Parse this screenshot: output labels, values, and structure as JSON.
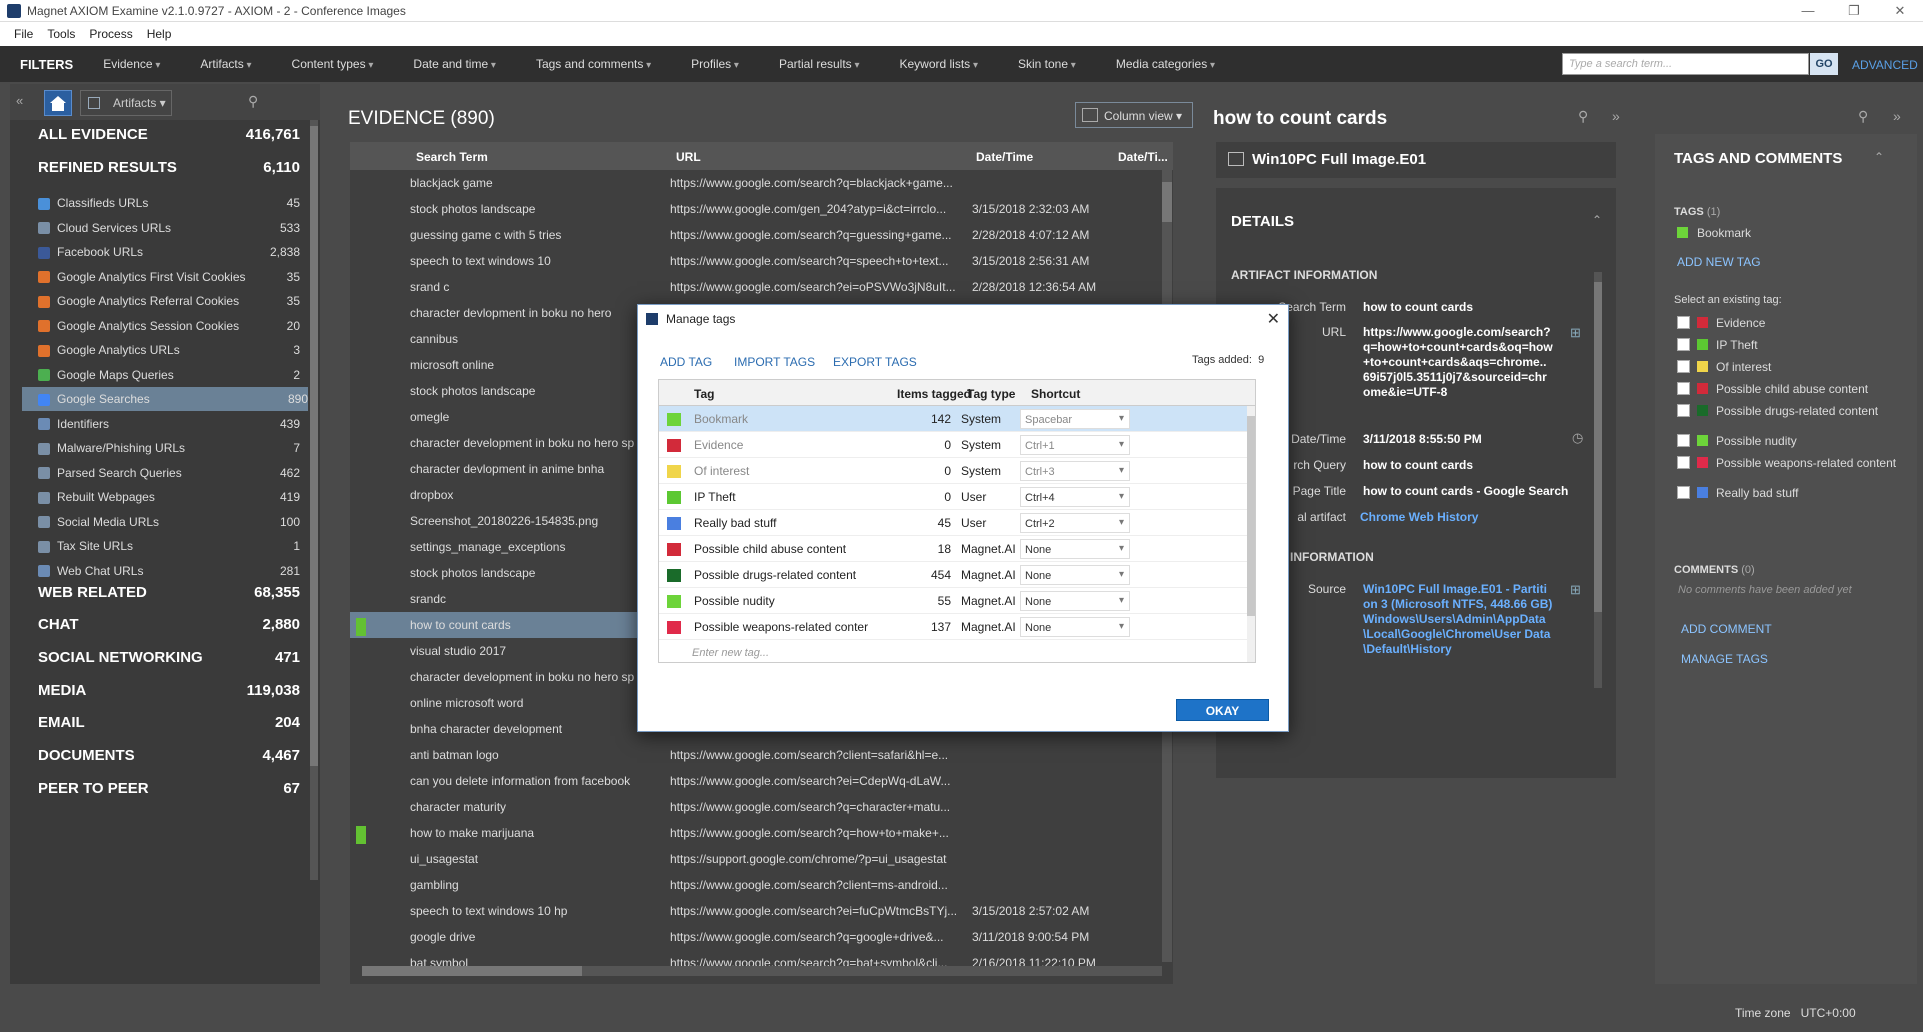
{
  "window": {
    "title": "Magnet AXIOM Examine v2.1.0.9727 - AXIOM - 2 - Conference Images"
  },
  "menu": [
    "File",
    "Tools",
    "Process",
    "Help"
  ],
  "filters": {
    "label": "FILTERS",
    "items": [
      "Evidence",
      "Artifacts",
      "Content types",
      "Date and time",
      "Tags and comments",
      "Profiles",
      "Partial results",
      "Keyword lists",
      "Skin tone",
      "Media categories"
    ],
    "search_placeholder": "Type a search term...",
    "go": "GO",
    "advanced": "ADVANCED"
  },
  "left": {
    "artifacts_btn": "Artifacts",
    "all_evidence": {
      "label": "ALL EVIDENCE",
      "count": "416,761"
    },
    "refined": {
      "label": "REFINED RESULTS",
      "count": "6,110"
    },
    "items": [
      {
        "label": "Classifieds URLs",
        "count": "45",
        "color": "#4a90d9"
      },
      {
        "label": "Cloud Services URLs",
        "count": "533",
        "color": "#7a8fa6"
      },
      {
        "label": "Facebook URLs",
        "count": "2,838",
        "color": "#3b5998"
      },
      {
        "label": "Google Analytics First Visit Cookies",
        "count": "35",
        "color": "#e0712c"
      },
      {
        "label": "Google Analytics Referral Cookies",
        "count": "35",
        "color": "#e0712c"
      },
      {
        "label": "Google Analytics Session Cookies",
        "count": "20",
        "color": "#e0712c"
      },
      {
        "label": "Google Analytics URLs",
        "count": "3",
        "color": "#e0712c"
      },
      {
        "label": "Google Maps Queries",
        "count": "2",
        "color": "#4caf50"
      },
      {
        "label": "Google Searches",
        "count": "890",
        "color": "#4285f4"
      },
      {
        "label": "Identifiers",
        "count": "439",
        "color": "#6b8bb5"
      },
      {
        "label": "Malware/Phishing URLs",
        "count": "7",
        "color": "#7a8fa6"
      },
      {
        "label": "Parsed Search Queries",
        "count": "462",
        "color": "#7a8fa6"
      },
      {
        "label": "Rebuilt Webpages",
        "count": "419",
        "color": "#7a8fa6"
      },
      {
        "label": "Social Media URLs",
        "count": "100",
        "color": "#7a8fa6"
      },
      {
        "label": "Tax Site URLs",
        "count": "1",
        "color": "#7a8fa6"
      },
      {
        "label": "Web Chat URLs",
        "count": "281",
        "color": "#6b8bb5"
      }
    ],
    "sections": [
      {
        "label": "WEB RELATED",
        "count": "68,355"
      },
      {
        "label": "CHAT",
        "count": "2,880"
      },
      {
        "label": "SOCIAL NETWORKING",
        "count": "471"
      },
      {
        "label": "MEDIA",
        "count": "119,038"
      },
      {
        "label": "EMAIL",
        "count": "204"
      },
      {
        "label": "DOCUMENTS",
        "count": "4,467"
      },
      {
        "label": "PEER TO PEER",
        "count": "67"
      }
    ]
  },
  "evidence": {
    "title": "EVIDENCE (890)",
    "column_view": "Column view",
    "columns": [
      "Search Term",
      "URL",
      "Date/Time",
      "Date/Ti..."
    ],
    "rows": [
      {
        "term": "blackjack game",
        "url": "https://www.google.com/search?q=blackjack+game...",
        "date": ""
      },
      {
        "term": "stock photos landscape",
        "url": "https://www.google.com/gen_204?atyp=i&ct=irrclo...",
        "date": "3/15/2018 2:32:03 AM"
      },
      {
        "term": "guessing game c   with 5 tries",
        "url": "https://www.google.com/search?q=guessing+game...",
        "date": "2/28/2018 4:07:12 AM"
      },
      {
        "term": "speech to text windows 10",
        "url": "https://www.google.com/search?q=speech+to+text...",
        "date": "3/15/2018 2:56:31 AM"
      },
      {
        "term": "srand c",
        "url": "https://www.google.com/search?ei=oPSVWo3jN8uIt...",
        "date": "2/28/2018 12:36:54 AM"
      },
      {
        "term": "character devlopment in boku no hero",
        "url": "",
        "date": ""
      },
      {
        "term": "cannibus",
        "url": "",
        "date": ""
      },
      {
        "term": "microsoft online",
        "url": "",
        "date": ""
      },
      {
        "term": "stock photos landscape",
        "url": "",
        "date": ""
      },
      {
        "term": "omegle",
        "url": "",
        "date": ""
      },
      {
        "term": "character development in boku no hero sp",
        "url": "",
        "date": ""
      },
      {
        "term": "character devlopment in anime bnha",
        "url": "",
        "date": ""
      },
      {
        "term": "dropbox",
        "url": "",
        "date": ""
      },
      {
        "term": "Screenshot_20180226-154835.png",
        "url": "",
        "date": ""
      },
      {
        "term": "settings_manage_exceptions",
        "url": "",
        "date": ""
      },
      {
        "term": "stock photos landscape",
        "url": "",
        "date": ""
      },
      {
        "term": "srandc",
        "url": "",
        "date": ""
      },
      {
        "term": "how to count cards",
        "url": "",
        "date": ""
      },
      {
        "term": "visual studio 2017",
        "url": "",
        "date": ""
      },
      {
        "term": "character development in boku no hero sp",
        "url": "",
        "date": ""
      },
      {
        "term": "online microsoft word",
        "url": "",
        "date": ""
      },
      {
        "term": "bnha character development",
        "url": "",
        "date": ""
      },
      {
        "term": "anti batman logo",
        "url": "https://www.google.com/search?client=safari&hl=e...",
        "date": ""
      },
      {
        "term": "can you delete information from facebook",
        "url": "https://www.google.com/search?ei=CdepWq-dLaW...",
        "date": ""
      },
      {
        "term": "character maturity",
        "url": "https://www.google.com/search?q=character+matu...",
        "date": ""
      },
      {
        "term": "how to make marijuana",
        "url": "https://www.google.com/search?q=how+to+make+...",
        "date": ""
      },
      {
        "term": "ui_usagestat",
        "url": "https://support.google.com/chrome/?p=ui_usagestat",
        "date": ""
      },
      {
        "term": "gambling",
        "url": "https://www.google.com/search?client=ms-android...",
        "date": ""
      },
      {
        "term": "speech to text windows 10 hp",
        "url": "https://www.google.com/search?ei=fuCpWtmcBsTYj...",
        "date": "3/15/2018 2:57:02 AM"
      },
      {
        "term": "google drive",
        "url": "https://www.google.com/search?q=google+drive&...",
        "date": "3/11/2018 9:00:54 PM"
      },
      {
        "term": "bat symbol",
        "url": "https://www.google.com/search?q=bat+symbol&cli...",
        "date": "2/16/2018 11:22:10 PM"
      }
    ]
  },
  "details": {
    "heading": "how to count cards",
    "source_image": "Win10PC Full Image.E01",
    "section": "DETAILS",
    "artifact_info": "ARTIFACT INFORMATION",
    "search_term_label": "Search Term",
    "search_term": "how to count cards",
    "url_label": "URL",
    "url": "https://www.google.com/search?q=how+to+count+cards&oq=how+to+count+cards&aqs=chrome..69i57j0l5.3511j0j7&sourceid=chrome&ie=UTF-8",
    "datetime_label": "Date/Time",
    "datetime": "3/11/2018 8:55:50 PM",
    "query_label": "rch Query",
    "query": "how to count cards",
    "pagetitle_label": "Page Title",
    "pagetitle": "how to count cards - Google Search",
    "artifact_label": "al artifact",
    "artifact": "Chrome Web History",
    "info2": "INFORMATION",
    "source_label": "Source",
    "source": "Win10PC Full Image.E01 - Partition 3 (Microsoft NTFS, 448.66 GB) Windows\\Users\\Admin\\AppData\\Local\\Google\\Chrome\\User Data\\Default\\History"
  },
  "tags_panel": {
    "title": "TAGS AND COMMENTS",
    "tags_label": "TAGS",
    "tags_count": "(1)",
    "bookmark": "Bookmark",
    "add_new_tag": "ADD NEW TAG",
    "select_existing": "Select an existing tag:",
    "existing": [
      {
        "label": "Evidence",
        "color": "#d22a3a"
      },
      {
        "label": "IP Theft",
        "color": "#5cc832"
      },
      {
        "label": "Of interest",
        "color": "#f0d54a"
      },
      {
        "label": "Possible child abuse content",
        "color": "#d22a3a"
      },
      {
        "label": "Possible drugs-related content",
        "color": "#1a6b2a"
      },
      {
        "label": "Possible nudity",
        "color": "#6dd43a"
      },
      {
        "label": "Possible weapons-related content",
        "color": "#e02a4a"
      },
      {
        "label": "Really bad stuff",
        "color": "#4a7fe0"
      }
    ],
    "comments_label": "COMMENTS",
    "comments_count": "(0)",
    "no_comments": "No comments have been added yet",
    "add_comment": "ADD COMMENT",
    "manage_tags": "MANAGE TAGS"
  },
  "status": {
    "timezone_label": "Time zone",
    "timezone": "UTC+0:00"
  },
  "dialog": {
    "title": "Manage tags",
    "add_tag": "ADD TAG",
    "import_tags": "IMPORT TAGS",
    "export_tags": "EXPORT TAGS",
    "tags_added_label": "Tags added:",
    "tags_added": "9",
    "columns": [
      "Tag",
      "Items tagged",
      "Tag type",
      "Shortcut"
    ],
    "rows": [
      {
        "tag": "Bookmark",
        "count": "142",
        "type": "System",
        "shortcut": "Spacebar",
        "color": "#6dd43a"
      },
      {
        "tag": "Evidence",
        "count": "0",
        "type": "System",
        "shortcut": "Ctrl+1",
        "color": "#d22a3a"
      },
      {
        "tag": "Of interest",
        "count": "0",
        "type": "System",
        "shortcut": "Ctrl+3",
        "color": "#f0d54a"
      },
      {
        "tag": "IP Theft",
        "count": "0",
        "type": "User",
        "shortcut": "Ctrl+4",
        "color": "#5cc832"
      },
      {
        "tag": "Really bad stuff",
        "count": "45",
        "type": "User",
        "shortcut": "Ctrl+2",
        "color": "#4a7fe0"
      },
      {
        "tag": "Possible child abuse content",
        "count": "18",
        "type": "Magnet.AI",
        "shortcut": "None",
        "color": "#d22a3a"
      },
      {
        "tag": "Possible drugs-related content",
        "count": "454",
        "type": "Magnet.AI",
        "shortcut": "None",
        "color": "#1a6b2a"
      },
      {
        "tag": "Possible nudity",
        "count": "55",
        "type": "Magnet.AI",
        "shortcut": "None",
        "color": "#6dd43a"
      },
      {
        "tag": "Possible weapons-related conter",
        "count": "137",
        "type": "Magnet.AI",
        "shortcut": "None",
        "color": "#e02a4a"
      }
    ],
    "new_tag_placeholder": "Enter new tag...",
    "ok": "OKAY"
  }
}
